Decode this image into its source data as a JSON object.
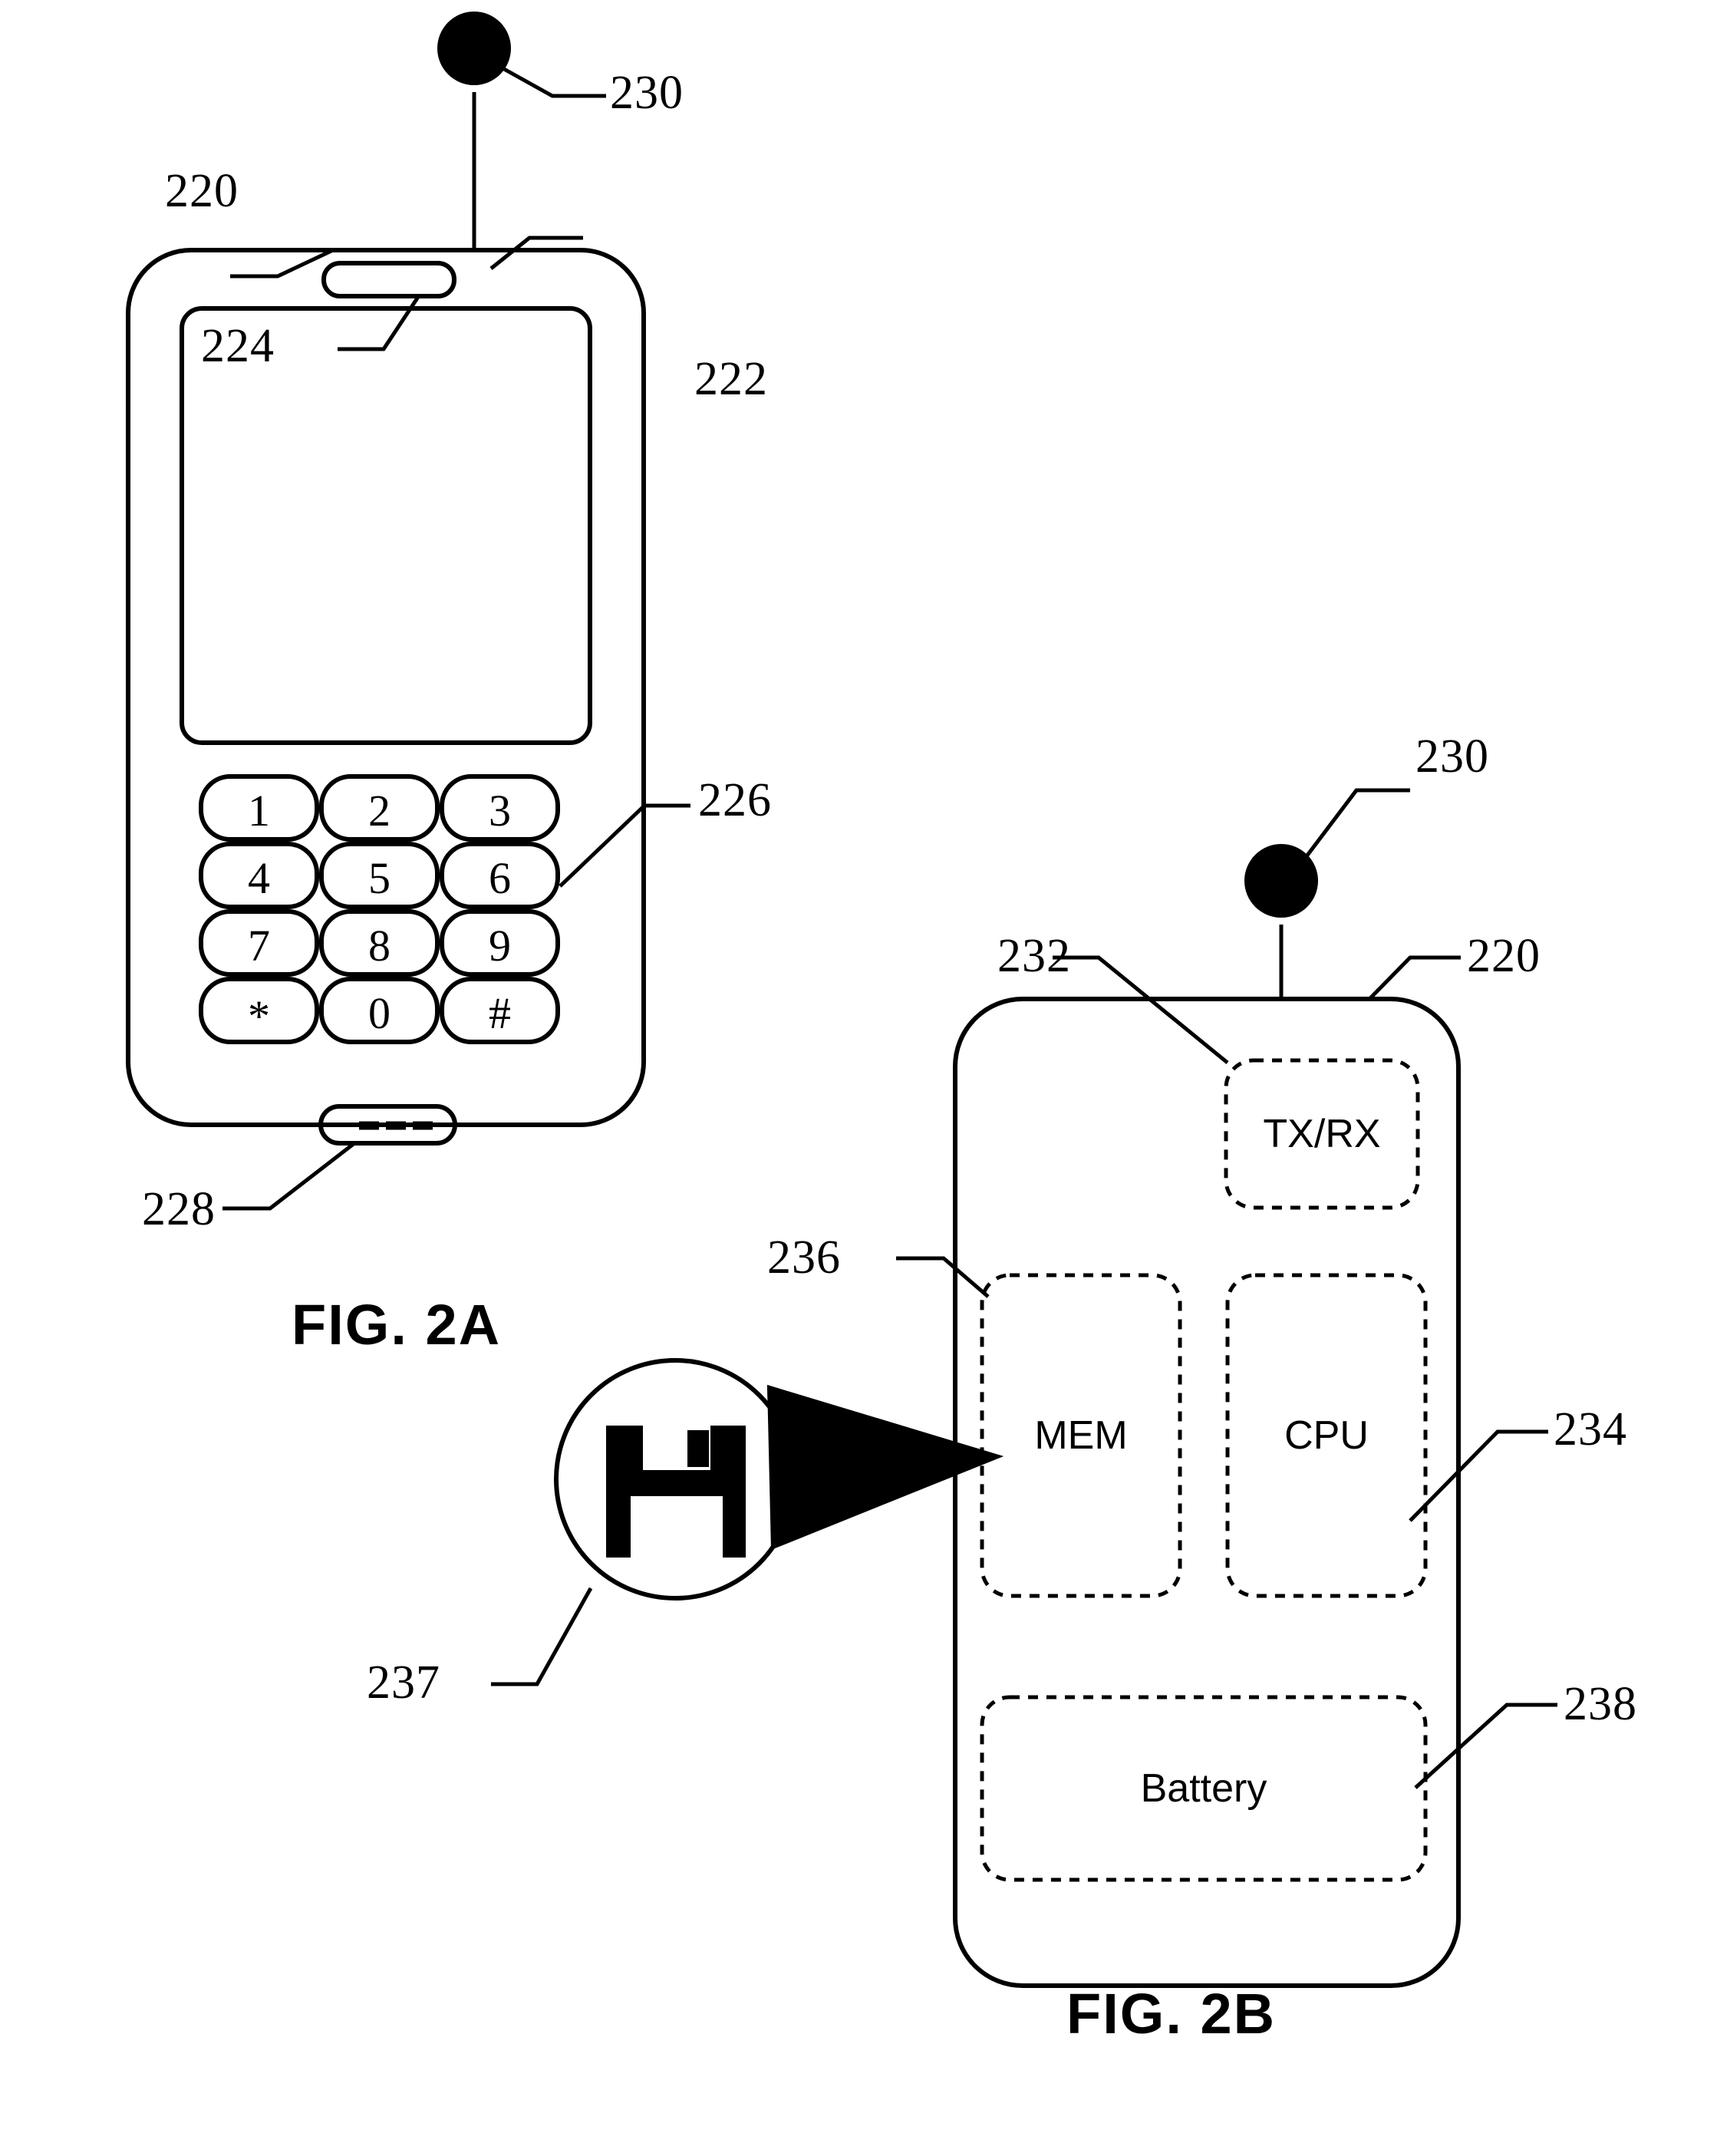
{
  "document": {
    "type": "patent-figure-sheet",
    "figures": [
      "FIG. 2A",
      "FIG. 2B"
    ]
  },
  "fig2a": {
    "caption": "FIG. 2A",
    "reference_numerals": {
      "device_body": "220",
      "display_screen": "222",
      "earpiece_speaker": "224",
      "keypad": "226",
      "microphone": "228",
      "antenna": "230"
    },
    "keypad": {
      "rows": [
        [
          "1",
          "2",
          "3"
        ],
        [
          "4",
          "5",
          "6"
        ],
        [
          "7",
          "8",
          "9"
        ],
        [
          "*",
          "0",
          "#"
        ]
      ]
    }
  },
  "fig2b": {
    "caption": "FIG. 2B",
    "reference_numerals": {
      "device_body": "220",
      "antenna": "230",
      "transceiver": "232",
      "processor": "234",
      "memory": "236",
      "memory_icon": "237",
      "battery": "238"
    },
    "blocks": [
      {
        "key": "transceiver",
        "label": "TX/RX",
        "ref": "232"
      },
      {
        "key": "memory",
        "label": "MEM",
        "ref": "236"
      },
      {
        "key": "processor",
        "label": "CPU",
        "ref": "234"
      },
      {
        "key": "battery",
        "label": "Battery",
        "ref": "238"
      }
    ],
    "callout": {
      "icon": "floppy-disk-icon",
      "ref": "237"
    }
  },
  "colors": {
    "ink": "#000000",
    "paper": "#ffffff"
  }
}
